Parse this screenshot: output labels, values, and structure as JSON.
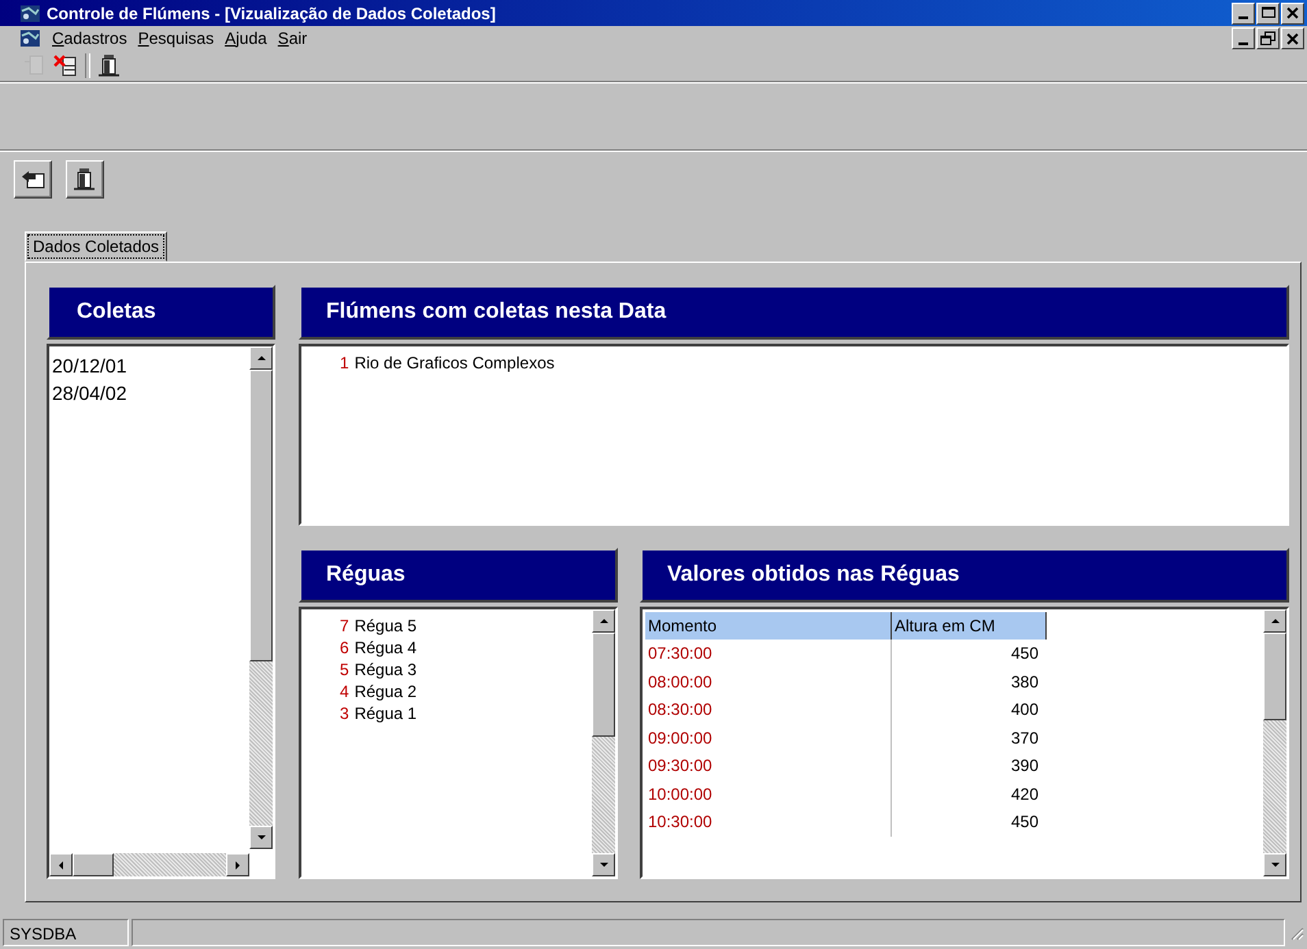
{
  "window": {
    "title": "Controle de Flúmens - [Vizualização de Dados Coletados]",
    "controls": [
      {
        "kind": "minimize"
      },
      {
        "kind": "maximize"
      },
      {
        "kind": "close"
      }
    ]
  },
  "menu": {
    "items": [
      "Cadastros",
      "Pesquisas",
      "Ajuda",
      "Sair"
    ],
    "controls": [
      {
        "kind": "minimize"
      },
      {
        "kind": "restore"
      },
      {
        "kind": "close"
      }
    ]
  },
  "toolbar": [
    {
      "kind": "new",
      "disabled": true
    },
    {
      "kind": "delete",
      "disabled": false
    },
    {
      "kind": "separator",
      "disabled": false
    },
    {
      "kind": "exit",
      "disabled": false
    }
  ],
  "toolbar2": [
    {
      "kind": "back"
    },
    {
      "kind": "exit"
    }
  ],
  "tabs": [
    {
      "label": "Dados Coletados",
      "selected": true
    }
  ],
  "coletas": {
    "title": "Coletas",
    "items": [
      "20/12/01",
      "28/04/02"
    ]
  },
  "flumens": {
    "title": "Flúmens com coletas nesta Data",
    "rows": [
      {
        "number": "1",
        "name": "Rio de Graficos Complexos"
      }
    ]
  },
  "reguas": {
    "title": "Réguas",
    "rows": [
      {
        "number": "7",
        "name": "Régua 5"
      },
      {
        "number": "6",
        "name": "Régua 4"
      },
      {
        "number": "5",
        "name": "Régua 3"
      },
      {
        "number": "4",
        "name": "Régua 2"
      },
      {
        "number": "3",
        "name": "Régua 1"
      }
    ]
  },
  "valores": {
    "title": "Valores obtidos nas Réguas",
    "columns": [
      "Momento",
      "Altura em CM"
    ],
    "rows": [
      [
        "07:30:00",
        "450"
      ],
      [
        "08:00:00",
        "380"
      ],
      [
        "08:30:00",
        "400"
      ],
      [
        "09:00:00",
        "370"
      ],
      [
        "09:30:00",
        "390"
      ],
      [
        "10:00:00",
        "420"
      ],
      [
        "10:30:00",
        "450"
      ]
    ]
  },
  "status_bar": [
    "SYSDBA"
  ]
}
